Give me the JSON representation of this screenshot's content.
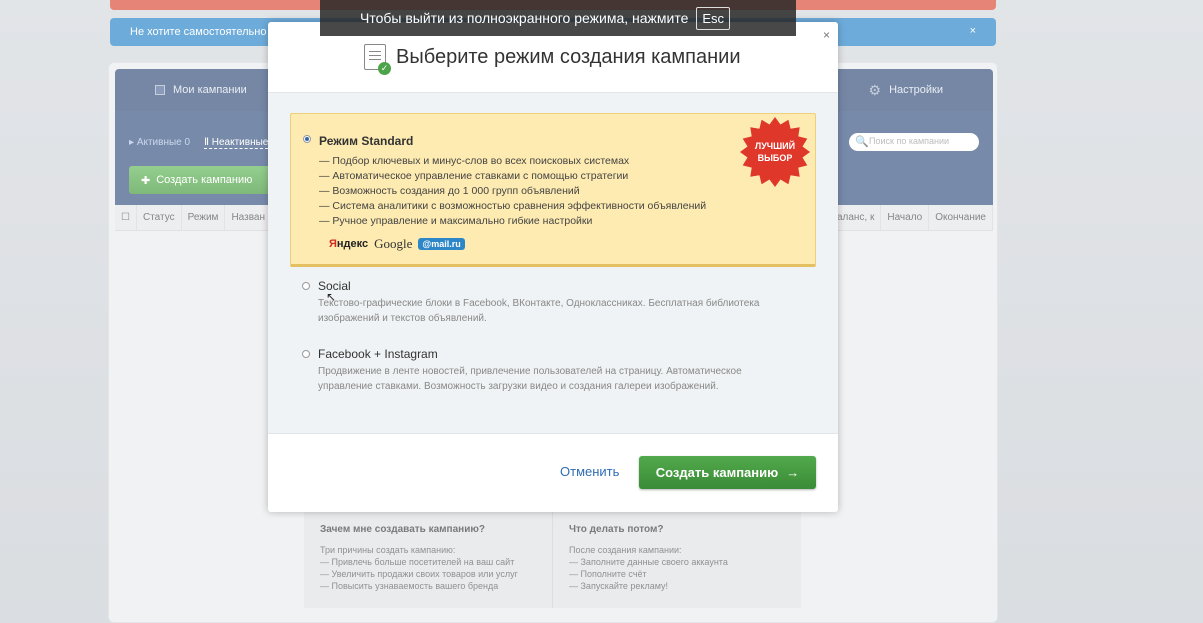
{
  "fullscreen_toast": {
    "text": "Чтобы выйти из полноэкранного режима, нажмите",
    "key": "Esc"
  },
  "info_bar": {
    "text": "Не хотите самостоятельно н",
    "close": "×"
  },
  "app": {
    "tabs": {
      "campaigns": "Мои кампании",
      "settings": "Настройки"
    },
    "filters": {
      "active": "Активные 0",
      "inactive": "Неактивные"
    },
    "create_button": "Создать кампанию",
    "search_placeholder": "Поиск по кампании",
    "table_headers": {
      "status": "Статус",
      "mode": "Режим",
      "name": "Назван",
      "balance": "Баланс, к",
      "start": "Начало",
      "end": "Окончание"
    }
  },
  "bottom_info": {
    "why": {
      "title": "Зачем мне создавать кампанию?",
      "lines": [
        "Три причины создать кампанию:",
        "— Привлечь больше посетителей на ваш сайт",
        "— Увеличить продажи своих товаров или услуг",
        "— Повысить узнаваемость вашего бренда"
      ]
    },
    "next": {
      "title": "Что делать потом?",
      "lines": [
        "После создания кампании:",
        "— Заполните данные своего аккаунта",
        "— Пополните счёт",
        "— Запускайте рекламу!"
      ]
    }
  },
  "modal": {
    "title": "Выберите режим создания кампании",
    "close": "×",
    "options": [
      {
        "title": "Режим Standard",
        "selected": true,
        "features": [
          "— Подбор ключевых и минус-слов во всех поисковых системах",
          "— Автоматическое управление ставками с помощью стратегии",
          "— Возможность создания до 1 000 групп объявлений",
          "— Система аналитики с возможностью сравнения эффективности объявлений",
          "— Ручное управление и максимально гибкие настройки"
        ],
        "logos": {
          "yandex_1": "Я",
          "yandex_2": "ндекс",
          "google": "Google",
          "mail": "@mail.ru"
        },
        "badge": {
          "line1": "ЛУЧШИЙ",
          "line2": "ВЫБОР",
          "color": "#e0372b"
        }
      },
      {
        "title": "Social",
        "selected": false,
        "description": "Текстово-графические блоки в Facebook, ВКонтакте, Одноклассниках. Бесплатная библиотека изображений и текстов объявлений."
      },
      {
        "title": "Facebook + Instagram",
        "selected": false,
        "description": "Продвижение в ленте новостей, привлечение пользователей на страницу. Автоматическое управление ставками. Возможность загрузки видео и создания галереи изображений."
      }
    ],
    "cancel": "Отменить",
    "create": "Создать кампанию",
    "create_arrow": "→"
  }
}
